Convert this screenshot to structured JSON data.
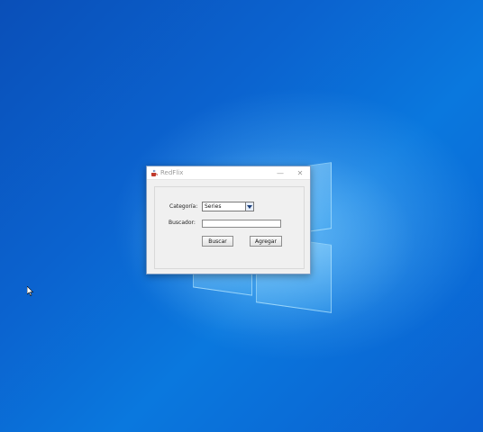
{
  "window": {
    "title": "RedFlix",
    "minimize_glyph": "—",
    "close_glyph": "✕"
  },
  "form": {
    "category_label": "Categoría:",
    "category_selected": "Series",
    "search_label": "Buscador:",
    "search_value": "",
    "search_button": "Buscar",
    "add_button": "Agregar"
  },
  "icons": {
    "app": "java-cup-icon",
    "dropdown": "chevron-down-icon",
    "cursor": "mouse-pointer-icon"
  },
  "colors": {
    "desktop": "#0b63cf",
    "window_bg": "#f0f0f0",
    "window_border": "#7c9cc4"
  }
}
